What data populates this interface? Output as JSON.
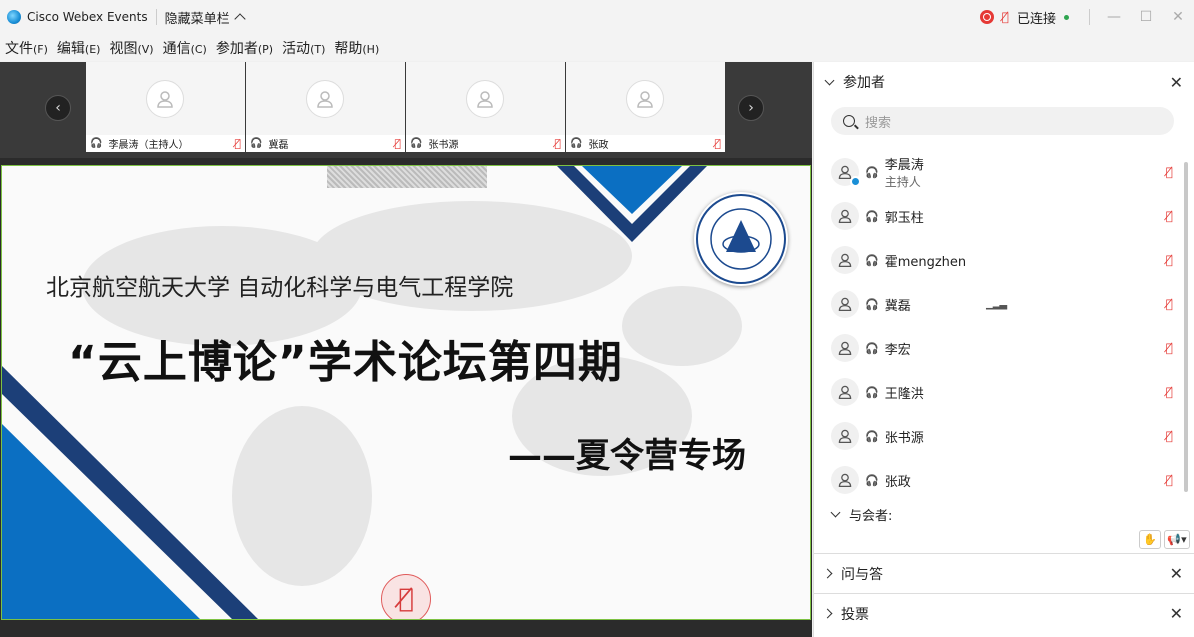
{
  "titlebar": {
    "app_title": "Cisco Webex Events",
    "hide_menu_label": "隐藏菜单栏",
    "connection_status": "已连接"
  },
  "menubar": [
    {
      "label": "文件",
      "key": "(F)"
    },
    {
      "label": "编辑",
      "key": "(E)"
    },
    {
      "label": "视图",
      "key": "(V)"
    },
    {
      "label": "通信",
      "key": "(C)"
    },
    {
      "label": "参加者",
      "key": "(P)"
    },
    {
      "label": "活动",
      "key": "(T)"
    },
    {
      "label": "帮助",
      "key": "(H)"
    }
  ],
  "video_tiles": [
    {
      "name": "李晨涛（主持人）"
    },
    {
      "name": "冀磊"
    },
    {
      "name": "张书源"
    },
    {
      "name": "张政"
    }
  ],
  "slide": {
    "line1": "北京航空航天大学  自动化科学与电气工程学院",
    "line2": "“云上博论”学术论坛第四期",
    "line3": "——夏令营专场",
    "seal_text_top": "北京航空航天大学",
    "seal_text_bottom": "BEIHANG UNIVERSITY",
    "seal_year": "1952"
  },
  "panel": {
    "title": "参加者",
    "search_placeholder": "搜索",
    "participants": [
      {
        "name": "李晨涛",
        "role": "主持人",
        "host": true
      },
      {
        "name": "郭玉柱",
        "role": ""
      },
      {
        "name": "霍mengzhen",
        "role": ""
      },
      {
        "name": "冀磊",
        "role": "",
        "speaking": true
      },
      {
        "name": "李宏",
        "role": ""
      },
      {
        "name": "王隆洪",
        "role": ""
      },
      {
        "name": "张书源",
        "role": ""
      },
      {
        "name": "张政",
        "role": ""
      }
    ],
    "attendees_label": "与会者:",
    "qa_label": "问与答",
    "poll_label": "投票"
  },
  "icons": {
    "mute": "mic-muted-icon",
    "headset": "headset-icon",
    "avatar": "person-icon"
  },
  "colors": {
    "mute_red": "#e53935",
    "slide_blue": "#0b6fc2",
    "slide_navy": "#1c3f78",
    "active_border": "#7dc243"
  }
}
